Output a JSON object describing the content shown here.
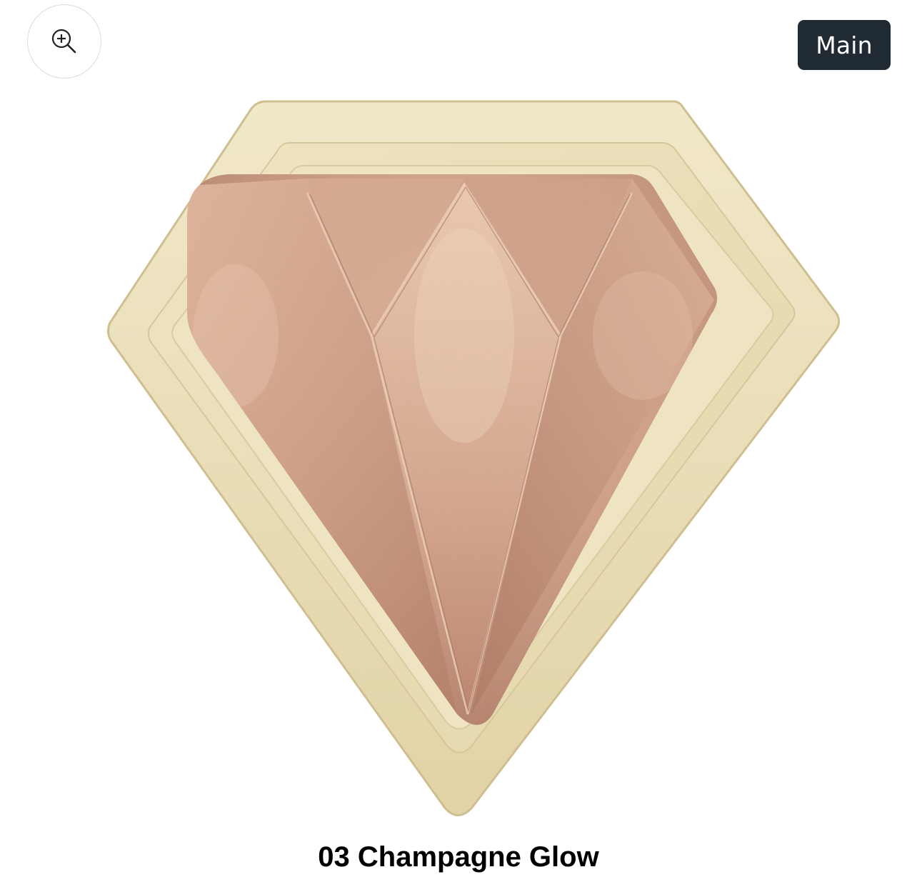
{
  "gallery": {
    "zoom_button": {
      "icon": "zoom-in-icon"
    },
    "badge_label": "Main"
  },
  "product": {
    "shade_name": "03 Champagne Glow",
    "colors": {
      "case_outer": "#e6d9b2",
      "case_inner": "#efe6c6",
      "powder_base": "#c79680",
      "powder_highlight": "#e9c3a8",
      "powder_shadow": "#a8725f"
    }
  }
}
